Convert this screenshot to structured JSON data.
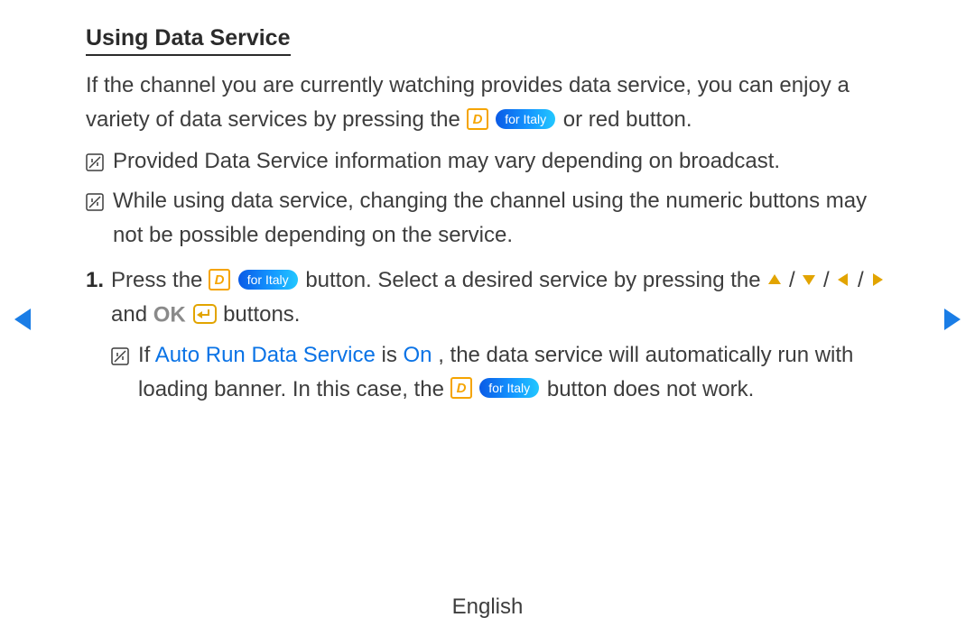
{
  "title": "Using Data Service",
  "intro": {
    "part1": "If the channel you are currently watching provides data service, you can enjoy a variety of data services by pressing the ",
    "part2": " or red button."
  },
  "badge_label": "for Italy",
  "notes": {
    "n1": "Provided Data Service information may vary depending on broadcast.",
    "n2": "While using data service, changing the channel using the numeric buttons may not be possible depending on the service."
  },
  "step1": {
    "num": "1.",
    "a": "Press the ",
    "b": " button. Select a desired service by pressing the ",
    "slash": " / ",
    "c": " and ",
    "ok": "OK",
    "d": " buttons."
  },
  "subnote": {
    "a": "If ",
    "auto": "Auto Run Data Service",
    "b": " is ",
    "on": "On",
    "c": ", the data service will automatically run with loading banner. In this case, the ",
    "d": " button does not work."
  },
  "footer": "English"
}
